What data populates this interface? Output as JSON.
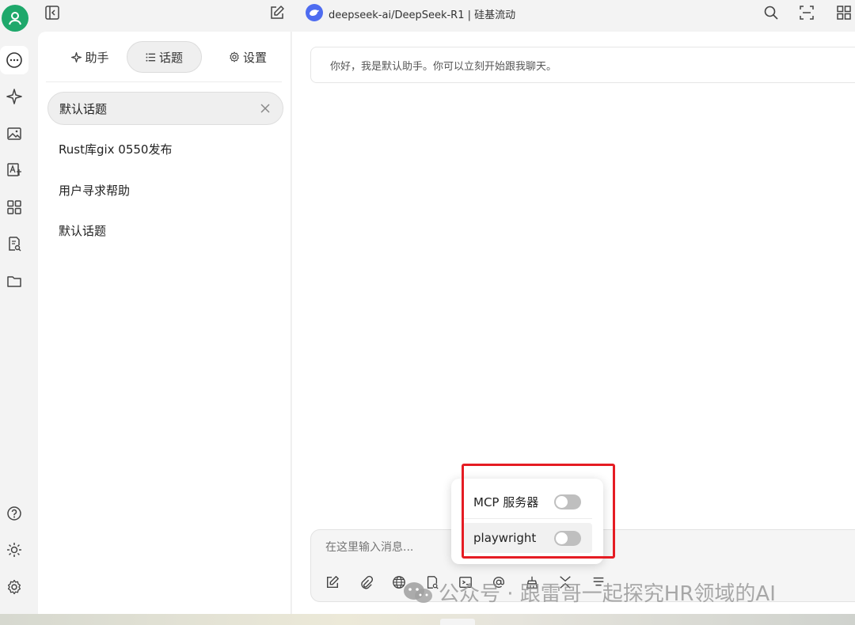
{
  "header": {
    "model_title": "deepseek-ai/DeepSeek-R1 | 硅基流动"
  },
  "sidebar_tabs": [
    {
      "label": "助手"
    },
    {
      "label": "话题"
    },
    {
      "label": "设置"
    }
  ],
  "topics": [
    {
      "label": "默认话题"
    },
    {
      "label": "Rust库gix 0550发布"
    },
    {
      "label": "用户寻求帮助"
    },
    {
      "label": "默认话题"
    }
  ],
  "chat": {
    "greeting": "你好，我是默认助手。你可以立刻开始跟我聊天。",
    "input_placeholder": "在这里输入消息..."
  },
  "mcp_popup": {
    "rows": [
      {
        "label": "MCP 服务器",
        "enabled": false
      },
      {
        "label": "playwright",
        "enabled": false
      }
    ]
  },
  "watermark": {
    "text": "公众号 · 跟雷哥一起探究HR领域的AI"
  },
  "colors": {
    "accent_green": "#1ea86b",
    "highlight_red": "#e51c23",
    "model_blue": "#4e6cf0"
  }
}
